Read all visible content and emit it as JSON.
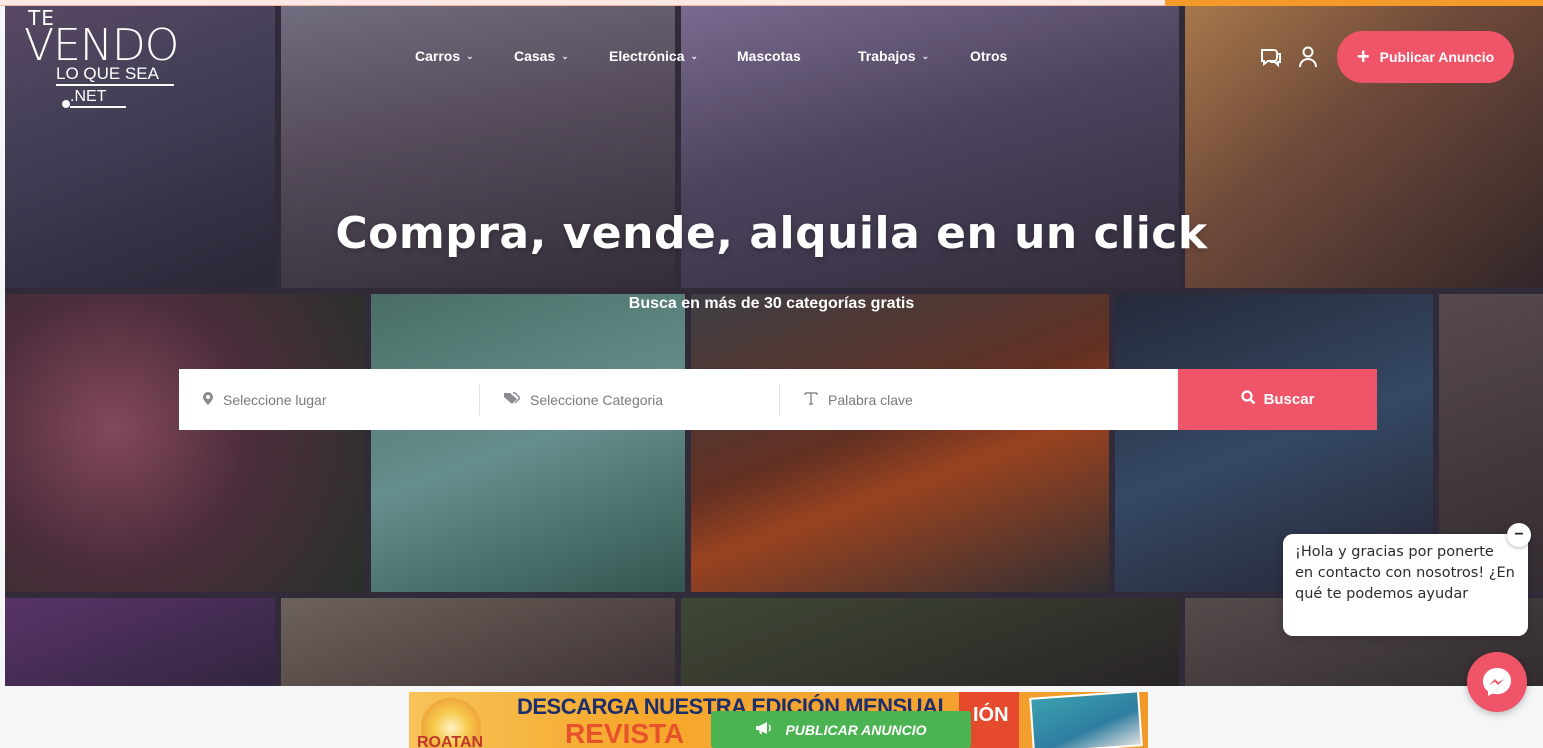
{
  "logo": {
    "line1": "TE",
    "line2": "VENDO",
    "line3": "LO QUE SEA",
    "line4": ".NET"
  },
  "nav": [
    {
      "label": "Carros",
      "has_dropdown": true
    },
    {
      "label": "Casas",
      "has_dropdown": true
    },
    {
      "label": "Electrónica",
      "has_dropdown": true
    },
    {
      "label": "Mascotas",
      "has_dropdown": false
    },
    {
      "label": "Trabajos",
      "has_dropdown": true
    },
    {
      "label": "Otros",
      "has_dropdown": false
    }
  ],
  "header": {
    "chat_icon": "chat-icon",
    "user_icon": "user-icon",
    "publish_label": "Publicar Anuncio"
  },
  "hero": {
    "title": "Compra, vende, alquila en un click",
    "subtitle": "Busca en más de 30 categorías gratis"
  },
  "search": {
    "location_placeholder": "Seleccione lugar",
    "category_placeholder": "Seleccione Categoria",
    "keyword_placeholder": "Palabra clave",
    "button_label": "Buscar"
  },
  "chat": {
    "message": "¡Hola y gracias por ponerte en contacto con nosotros! ¿En qué te podemos ayudar",
    "close_label": "−"
  },
  "banner": {
    "download_text": "DESCARGA NUESTRA EDICIÓN MENSUAL",
    "revista": "REVISTA",
    "roatan": "ROATAN",
    "edition_badge": "IÓN",
    "publish_label": "PUBLICAR ANUNCIO"
  },
  "colors": {
    "accent": "#f05468",
    "green": "#4bb352",
    "orange_strip": "#f39a2b"
  }
}
